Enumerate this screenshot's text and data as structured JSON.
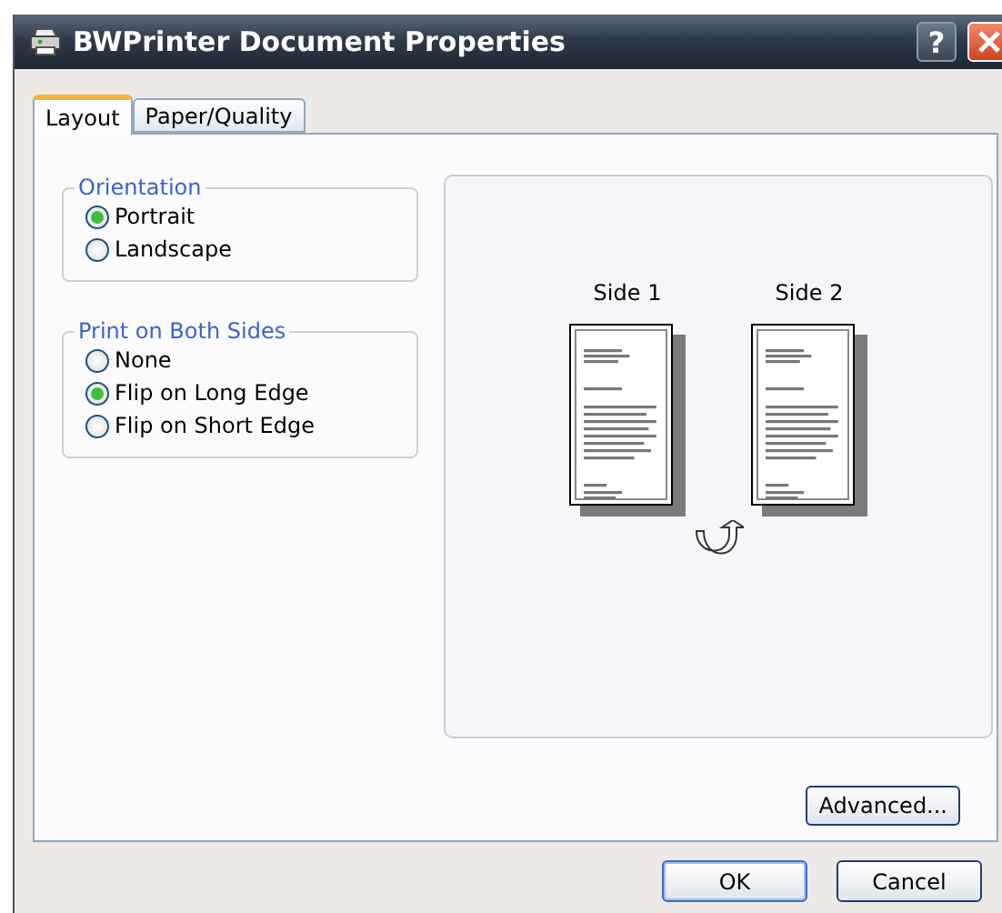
{
  "window": {
    "title": "BWPrinter Document Properties",
    "help": "?"
  },
  "tabs": [
    {
      "label": "Layout",
      "selected": true
    },
    {
      "label": "Paper/Quality",
      "selected": false
    }
  ],
  "groups": [
    {
      "title": "Orientation",
      "options": [
        {
          "label": "Portrait",
          "selected": true
        },
        {
          "label": "Landscape",
          "selected": false
        }
      ]
    },
    {
      "title": "Print on Both Sides",
      "options": [
        {
          "label": "None",
          "selected": false
        },
        {
          "label": "Flip on Long Edge",
          "selected": true
        },
        {
          "label": "Flip on Short Edge",
          "selected": false
        }
      ]
    }
  ],
  "preview": {
    "sides": [
      "Side 1",
      "Side 2"
    ]
  },
  "advanced_button": "Advanced...",
  "buttons": [
    "OK",
    "Cancel"
  ]
}
